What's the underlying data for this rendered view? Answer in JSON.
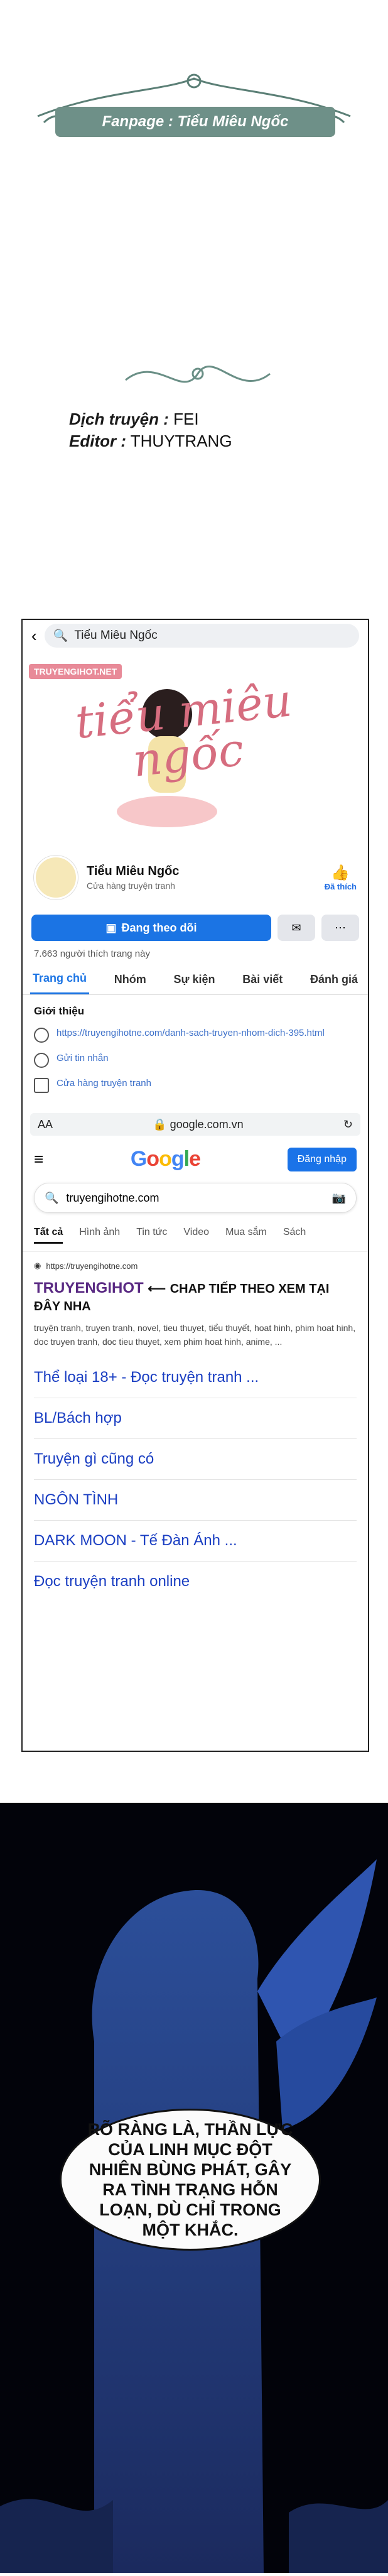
{
  "header": {
    "fanpage_label": "Fanpage : Tiểu Miêu Ngốc",
    "translator_label": "Dịch truyện :",
    "translator": "FEI",
    "editor_label": "Editor :",
    "editor": "THUYTRANG"
  },
  "facebook": {
    "search_value": "Tiểu Miêu Ngốc",
    "cover_brand": "TRUYENGIHOT.NET",
    "cover_title": "tiểu miêu ngốc",
    "page_name": "Tiểu Miêu Ngốc",
    "page_category": "Cửa hàng truyện tranh",
    "like_label": "Đã thích",
    "follow_label": "Đang theo dõi",
    "likes_count": "7.663 người thích trang này",
    "tabs": [
      "Trang chủ",
      "Nhóm",
      "Sự kiện",
      "Bài viết",
      "Đánh giá"
    ],
    "intro_title": "Giới thiệu",
    "intro_items": [
      "https://truyengihotne.com/danh-sach-truyen-nhom-dich-395.html",
      "Gửi tin nhắn",
      "Cửa hàng truyện tranh"
    ]
  },
  "browser": {
    "aa": "AA",
    "url": "google.com.vn"
  },
  "google": {
    "logo": "Google",
    "login_label": "Đăng nhập",
    "query": "truyengihotne.com",
    "tabs": [
      "Tất cả",
      "Hình ảnh",
      "Tin tức",
      "Video",
      "Mua sắm",
      "Sách"
    ],
    "result_url": "https://truyengihotne.com",
    "result_title": "TRUYENGIHOT",
    "result_title_note": "CHAP TIẾP THEO XEM TẠI ĐÂY NHA",
    "result_desc": "truyện tranh, truyen tranh, novel, tieu thuyet, tiểu thuyết, hoat hinh, phim hoat hinh, doc truyen tranh, doc tieu thuyet, xem phim hoat hinh, anime, ...",
    "links": [
      "Thể loại 18+ - Đọc truyện tranh ...",
      "BL/Bách hợp",
      "Truyện gì cũng có",
      "NGÔN TÌNH",
      "DARK MOON - Tế Đàn Ánh ...",
      "Đọc truyện tranh online"
    ]
  },
  "comic": {
    "bubble_text": "RÕ RÀNG LÀ, THẦN LỰC CỦA LINH MỤC ĐỘT NHIÊN BÙNG PHÁT, GÂY RA TÌNH TRẠNG HỖN LOẠN, DÙ CHỈ TRONG MỘT KHẮC."
  }
}
